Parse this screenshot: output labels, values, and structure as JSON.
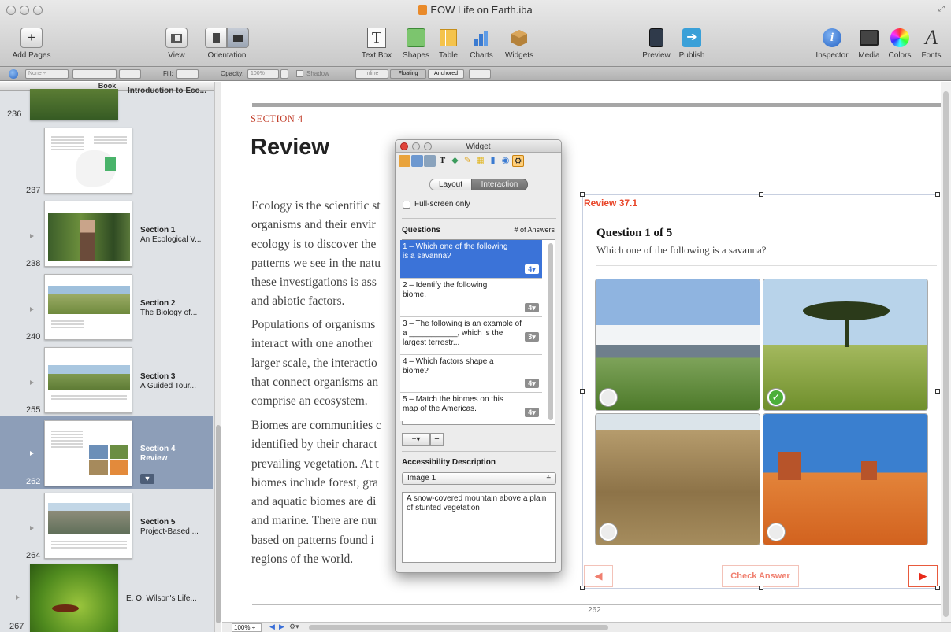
{
  "window": {
    "title": "EOW Life on Earth.iba"
  },
  "toolbar": {
    "add_pages": "Add Pages",
    "view": "View",
    "orientation": "Orientation",
    "text_box": "Text Box",
    "shapes": "Shapes",
    "table": "Table",
    "charts": "Charts",
    "widgets": "Widgets",
    "preview": "Preview",
    "publish": "Publish",
    "inspector": "Inspector",
    "media": "Media",
    "colors": "Colors",
    "fonts": "Fonts"
  },
  "format_bar": {
    "stroke_value": "None",
    "fill_label": "Fill:",
    "opacity_label": "Opacity:",
    "opacity_value": "100%",
    "shadow_label": "Shadow",
    "inline": "Inline",
    "floating": "Floating",
    "anchored": "Anchored"
  },
  "sidebar": {
    "header": "Book",
    "items": [
      {
        "page": "236",
        "title": "Introduction to Eco..."
      },
      {
        "page": "237"
      },
      {
        "page": "238",
        "label": "Section 1",
        "title": "An Ecological V..."
      },
      {
        "page": "240",
        "label": "Section 2",
        "title": "The Biology of..."
      },
      {
        "page": "255",
        "label": "Section 3",
        "title": "A Guided Tour..."
      },
      {
        "page": "262",
        "label": "Section 4",
        "title": "Review"
      },
      {
        "page": "264",
        "label": "Section 5",
        "title": "Project-Based ..."
      },
      {
        "page": "267",
        "title": "E. O. Wilson's Life..."
      }
    ]
  },
  "page": {
    "section_kicker": "SECTION 4",
    "heading": "Review",
    "paragraphs": [
      [
        "Ecology is the scientific st",
        "organisms and their envir",
        "ecology is to discover the",
        "patterns we see in the natu",
        "these investigations is ass",
        "and abiotic factors."
      ],
      [
        "Populations of organisms",
        "interact with one another",
        "larger scale, the interactio",
        "that connect organisms an",
        "comprise an ecosystem."
      ],
      [
        "Biomes are communities c",
        "identified by their charact",
        "prevailing vegetation. At t",
        "biomes include forest, gra",
        "and aquatic biomes are di",
        "and marine. There are nur",
        "based on patterns found i",
        "regions of the world."
      ]
    ],
    "page_number": "262"
  },
  "review_widget": {
    "title": "Review 37.1",
    "question_heading": "Question 1 of 5",
    "question_text": "Which one of the following is a savanna?",
    "check_answer": "Check Answer"
  },
  "inspector": {
    "title": "Widget",
    "tab_layout": "Layout",
    "tab_interaction": "Interaction",
    "fullscreen_label": "Full-screen only",
    "questions_header": "Questions",
    "answers_header": "# of Answers",
    "questions": [
      {
        "text": "1 – Which one of the following is a savanna?",
        "answers": "4"
      },
      {
        "text": "2 – Identify the following biome.",
        "answers": "4"
      },
      {
        "text": "3 – The following is an example of a ___________, which is the largest terrestr...",
        "answers": "3"
      },
      {
        "text": "4 – Which factors shape a biome?",
        "answers": "4"
      },
      {
        "text": "5 – Match the biomes on this map of the Americas.",
        "answers": "4"
      }
    ],
    "accessibility_header": "Accessibility Description",
    "image_select": "Image 1",
    "description": "A snow-covered mountain above a plain of stunted vegetation"
  },
  "statusbar": {
    "zoom": "100%"
  }
}
